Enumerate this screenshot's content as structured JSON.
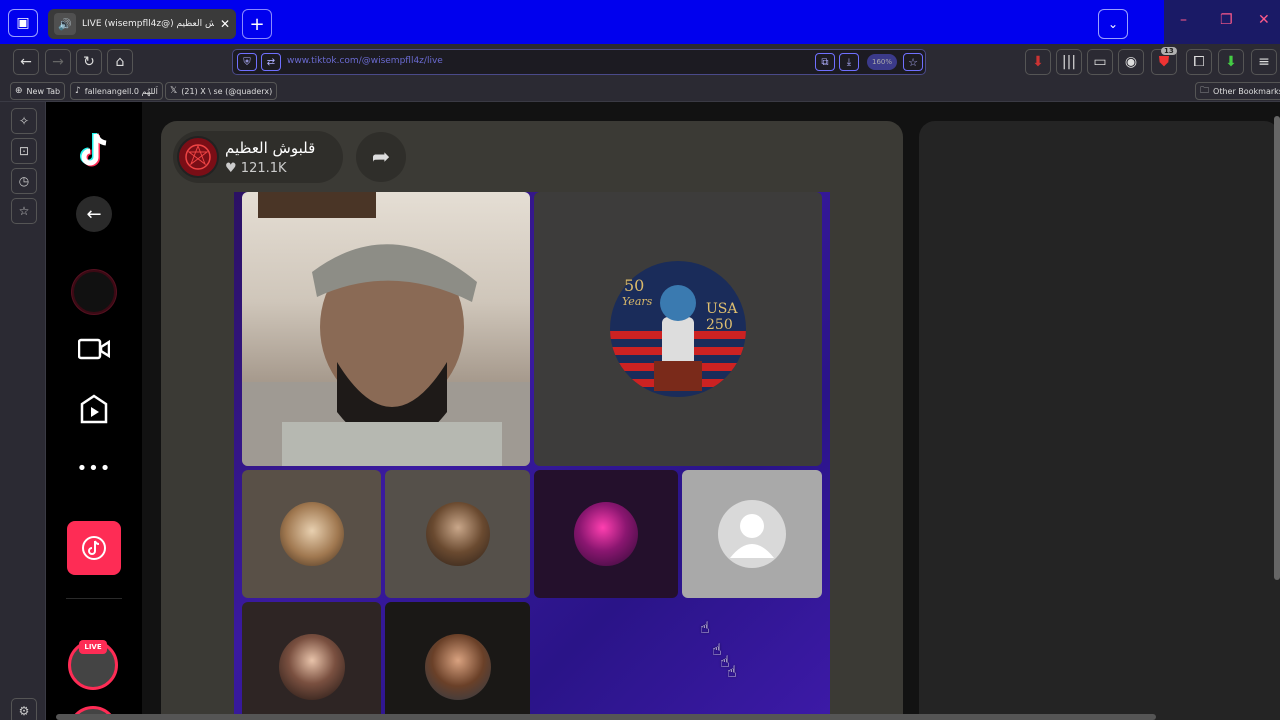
{
  "browser": {
    "tab_title": "LIVE (wisempfll4z@) قلبوش العظيم",
    "url": "www.tiktok.com/@wisempfll4z/live",
    "zoom": "160%",
    "extension_badge": "13"
  },
  "bookmarks": {
    "items": [
      {
        "label": "New Tab",
        "icon": "globe-icon"
      },
      {
        "label": "fallenangell.0 اَللهُم",
        "icon": "tiktok-icon"
      },
      {
        "label": "(21) X \\ se (@quaderx)",
        "icon": "x-icon"
      }
    ],
    "other_label": "Other Bookmarks"
  },
  "live": {
    "host_name": "قلبوش العظيم",
    "likes": "121.1K",
    "featured_card_text": [
      "50",
      "Years",
      "USA",
      "250"
    ],
    "live_badge": "LIVE"
  },
  "colors": {
    "tiktok_red": "#fe2c55",
    "tab_bar": "#0000ee",
    "grid_purple": "#3a1aa0"
  }
}
